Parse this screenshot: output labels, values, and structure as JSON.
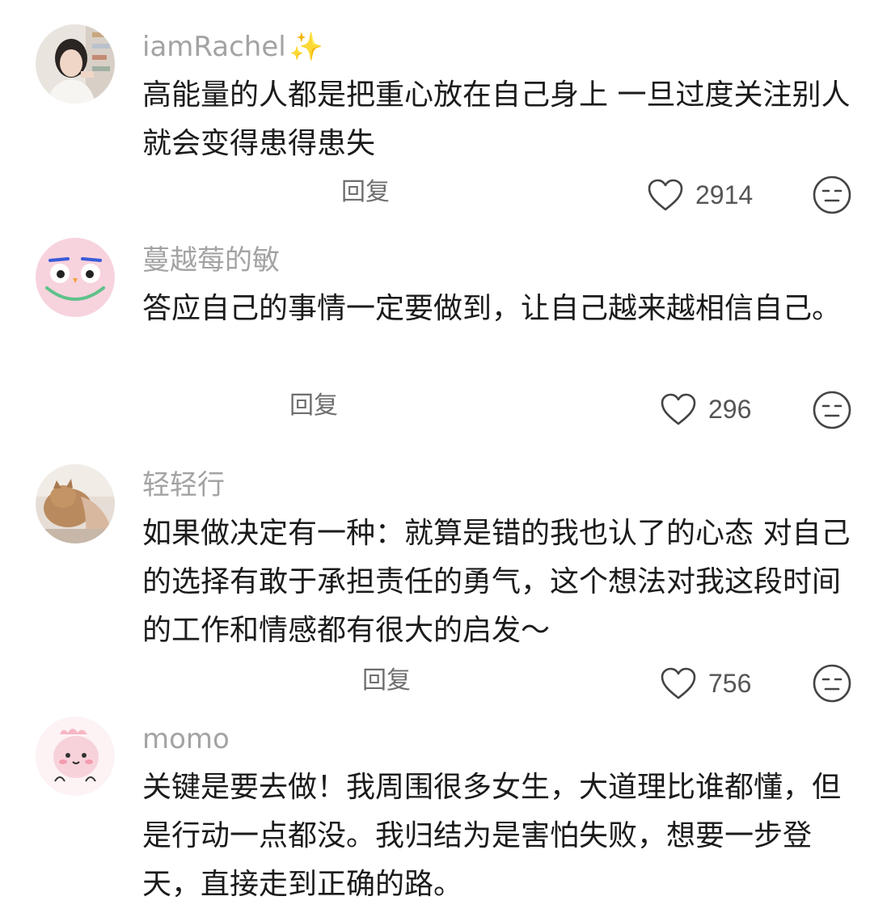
{
  "comments": [
    {
      "username": "iamRachel",
      "username_emoji": "✨",
      "text": "高能量的人都是把重心放在自己身上 一旦过度关注别人 就会变得患得患失",
      "reply_label": "回复",
      "likes": "2914",
      "avatar_icon": "person-photo-avatar"
    },
    {
      "username": "蔓越莓的敏",
      "text": "答应自己的事情一定要做到，让自己越来越相信自己。",
      "reply_label": "回复",
      "likes": "296",
      "avatar_icon": "pink-cartoon-owl-avatar"
    },
    {
      "username": "轻轻行",
      "text": "如果做决定有一种：就算是错的我也认了的心态 对自己的选择有敢于承担责任的勇气，这个想法对我这段时间的工作和情感都有很大的启发～",
      "reply_label": "回复",
      "likes": "756",
      "avatar_icon": "cat-photo-avatar"
    },
    {
      "username": "momo",
      "text": "关键是要去做！我周围很多女生，大道理比谁都懂，但是行动一点都没。我归结为是害怕失败，想要一步登天，直接走到正确的路。",
      "avatar_icon": "pink-cartoon-dino-avatar"
    }
  ],
  "colors": {
    "username": "#a3a3a3",
    "text": "#1b1b1b",
    "meta": "#6e6e6e",
    "background": "#ffffff"
  }
}
